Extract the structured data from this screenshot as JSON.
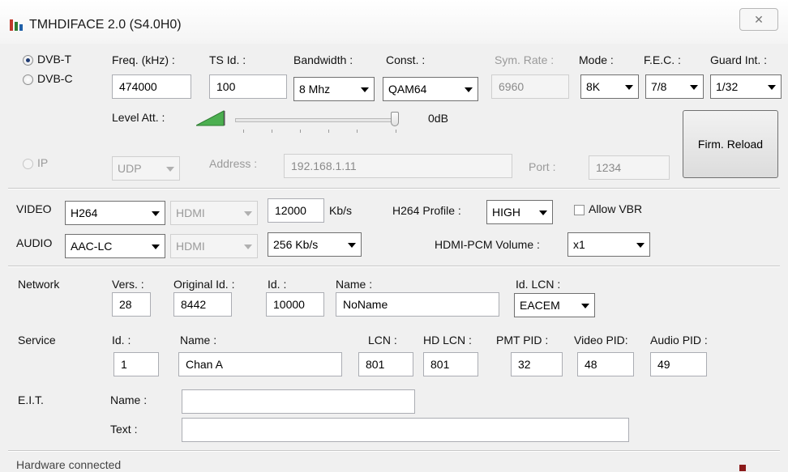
{
  "window": {
    "title": "TMHDIFACE 2.0 (S4.0H0)",
    "close_glyph": "✕"
  },
  "tuner": {
    "dvbt_label": "DVB-T",
    "dvbc_label": "DVB-C",
    "freq_label": "Freq. (kHz) :",
    "freq_value": "474000",
    "tsid_label": "TS Id. :",
    "tsid_value": "100",
    "bandwidth_label": "Bandwidth :",
    "bandwidth_value": "8 Mhz",
    "const_label": "Const. :",
    "const_value": "QAM64",
    "symrate_label": "Sym. Rate :",
    "symrate_value": "6960",
    "mode_label": "Mode :",
    "mode_value": "8K",
    "fec_label": "F.E.C. :",
    "fec_value": "7/8",
    "guard_label": "Guard Int. :",
    "guard_value": "1/32",
    "level_label": "Level Att. :",
    "level_value": "0dB",
    "firm_reload_label": "Firm. Reload"
  },
  "ip": {
    "ip_label": "IP",
    "protocol_value": "UDP",
    "address_label": "Address :",
    "address_value": "192.168.1.11",
    "port_label": "Port :",
    "port_value": "1234"
  },
  "video": {
    "label": "VIDEO",
    "codec_value": "H264",
    "source_value": "HDMI",
    "bitrate_value": "12000",
    "bitrate_unit": "Kb/s",
    "profile_label": "H264 Profile :",
    "profile_value": "HIGH",
    "allow_vbr_label": "Allow VBR"
  },
  "audio": {
    "label": "AUDIO",
    "codec_value": "AAC-LC",
    "source_value": "HDMI",
    "bitrate_value": "256 Kb/s",
    "pcm_volume_label": "HDMI-PCM Volume :",
    "pcm_volume_value": "x1"
  },
  "network": {
    "label": "Network",
    "vers_label": "Vers. :",
    "vers_value": "28",
    "orig_id_label": "Original Id. :",
    "orig_id_value": "8442",
    "id_label": "Id. :",
    "id_value": "10000",
    "name_label": "Name :",
    "name_value": "NoName",
    "lcn_label": "Id. LCN :",
    "lcn_value": "EACEM"
  },
  "service": {
    "label": "Service",
    "id_label": "Id. :",
    "id_value": "1",
    "name_label": "Name :",
    "name_value": "Chan A",
    "lcn_label": "LCN :",
    "lcn_value": "801",
    "hdlcn_label": "HD LCN :",
    "hdlcn_value": "801",
    "pmt_label": "PMT PID :",
    "pmt_value": "32",
    "video_pid_label": "Video PID:",
    "video_pid_value": "48",
    "audio_pid_label": "Audio PID :",
    "audio_pid_value": "49"
  },
  "eit": {
    "label": "E.I.T.",
    "name_label": "Name :",
    "name_value": "",
    "text_label": "Text :",
    "text_value": ""
  },
  "status": {
    "text": "Hardware connected"
  }
}
